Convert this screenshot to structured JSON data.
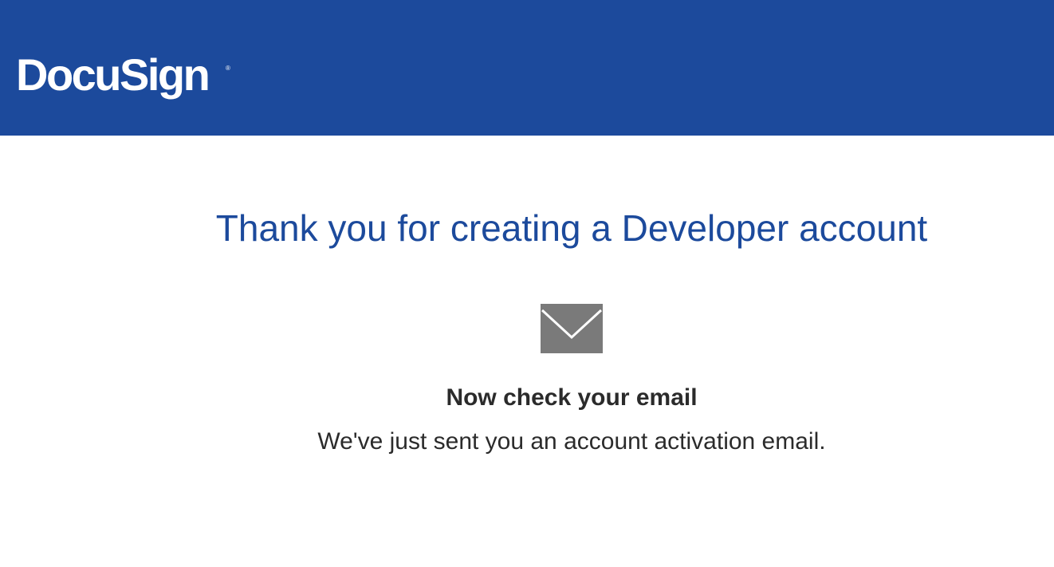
{
  "header": {
    "brand": "DocuSign",
    "brand_mark": "®",
    "background_color": "#1c4a9c"
  },
  "main": {
    "title": "Thank you for creating a Developer account",
    "title_color": "#1c4a9c",
    "icon": "envelope-icon",
    "subtitle": "Now check your email",
    "message": "We've just sent you an account activation email."
  }
}
